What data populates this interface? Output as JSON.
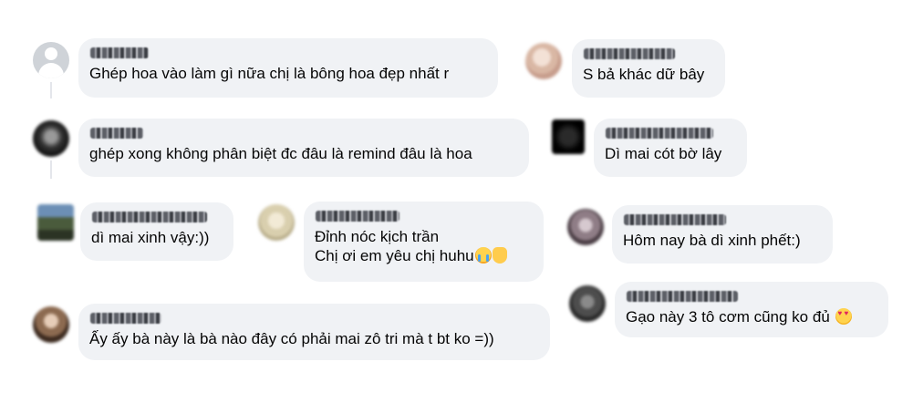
{
  "comments": [
    {
      "id": "c1",
      "avatar_icon": "default-profile-icon",
      "lines": [
        "Ghép hoa vào làm gì nữa chị là bông hoa đẹp nhất r"
      ]
    },
    {
      "id": "c2",
      "avatar_icon": "blurred-profile-photo",
      "lines": [
        "S bả khác dữ bây"
      ]
    },
    {
      "id": "c3",
      "avatar_icon": "blurred-profile-photo",
      "lines": [
        "ghép xong không phân biệt đc đâu là remind đâu là hoa"
      ]
    },
    {
      "id": "c4",
      "avatar_icon": "blurred-profile-photo",
      "lines": [
        "Dì mai cót bờ lây"
      ]
    },
    {
      "id": "c5",
      "avatar_icon": "blurred-profile-photo",
      "lines": [
        "dì mai xinh vậy:))"
      ]
    },
    {
      "id": "c6",
      "avatar_icon": "blurred-profile-photo",
      "lines": [
        "Đỉnh nóc kịch trần",
        "Chị ơi em yêu chị huhu"
      ],
      "trailing_emoji": [
        "loudly-crying-face-emoji",
        "heart-hands-emoji"
      ]
    },
    {
      "id": "c7",
      "avatar_icon": "blurred-profile-photo",
      "lines": [
        "Hôm nay bà dì xinh phết:)"
      ]
    },
    {
      "id": "c8",
      "avatar_icon": "blurred-profile-photo",
      "lines": [
        "Gạo này 3 tô cơm cũng ko đủ"
      ],
      "trailing_emoji": [
        "smiling-face-with-heart-eyes-emoji"
      ]
    },
    {
      "id": "c9",
      "avatar_icon": "blurred-profile-photo",
      "lines": [
        "Ấy ấy bà này là bà nào đây có phải mai zô tri mà t bt ko =))"
      ]
    }
  ],
  "colors": {
    "bubble": "#f0f2f5",
    "text": "#050505",
    "thread_line": "#e4e6eb"
  }
}
